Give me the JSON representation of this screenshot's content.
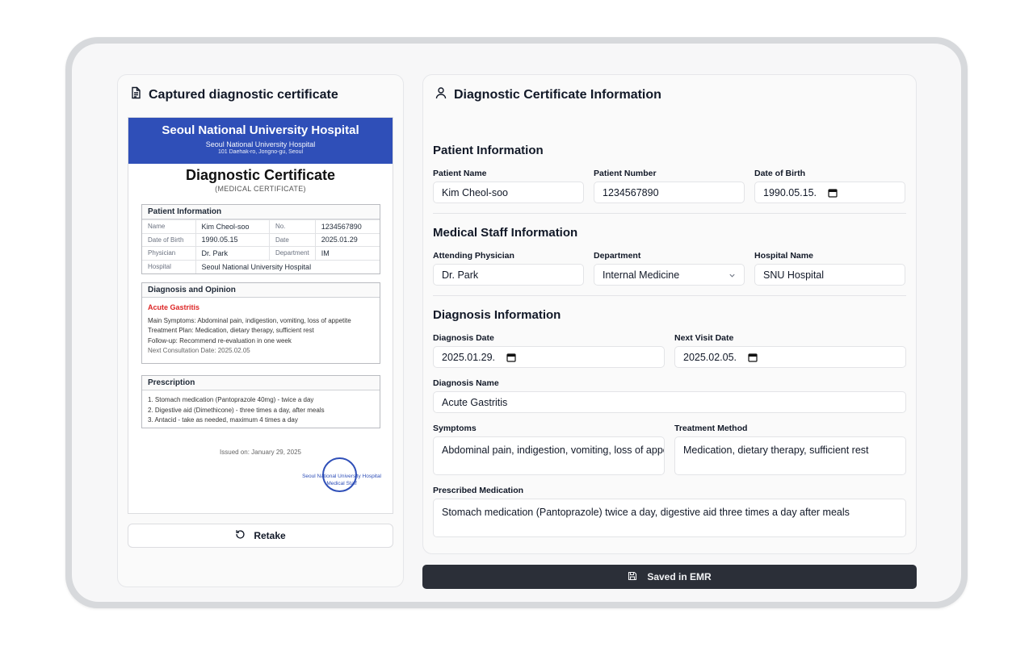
{
  "left": {
    "title": "Captured diagnostic certificate",
    "retake_label": "Retake"
  },
  "cert": {
    "hospital_name": "Seoul National University Hospital",
    "hospital_sub": "Seoul National University Hospital",
    "address": "101 Daehak-ro, Jongno-gu, Seoul",
    "title": "Diagnostic Certificate",
    "subtitle": "(MEDICAL CERTIFICATE)",
    "patient_info": {
      "heading": "Patient Information",
      "name_label": "Name",
      "name": "Kim Cheol-soo",
      "no_label": "No.",
      "no": "1234567890",
      "dob_label": "Date of Birth",
      "dob": "1990.05.15",
      "date_label": "Date",
      "date": "2025.01.29",
      "physician_label": "Physician",
      "physician": "Dr. Park",
      "department_label": "Department",
      "department": "IM",
      "hospital_label": "Hospital",
      "hospital": "Seoul National University Hospital"
    },
    "diagnosis": {
      "heading": "Diagnosis and Opinion",
      "name": "Acute Gastritis",
      "symptoms": "Main Symptoms: Abdominal pain, indigestion, vomiting, loss of appetite",
      "treatment": "Treatment Plan: Medication, dietary therapy, sufficient rest",
      "followup": "Follow-up: Recommend re-evaluation in one week",
      "next": "Next Consultation Date: 2025.02.05"
    },
    "prescription": {
      "heading": "Prescription",
      "items": [
        "1. Stomach medication (Pantoprazole 40mg) - twice a day",
        "2. Digestive aid (Dimethicone) - three times a day, after meals",
        "3. Antacid - take as needed, maximum 4 times a day"
      ]
    },
    "issued": "Issued on: January 29, 2025",
    "stamp_line1": "Seoul National University Hospital",
    "stamp_line2": "Medical Staff"
  },
  "right": {
    "title": "Diagnostic Certificate Information",
    "patient_section": "Patient Information",
    "patient_name_label": "Patient Name",
    "patient_name": "Kim Cheol-soo",
    "patient_number_label": "Patient Number",
    "patient_number": "1234567890",
    "dob_label": "Date of Birth",
    "dob": "1990.05.15.",
    "staff_section": "Medical Staff Information",
    "physician_label": "Attending Physician",
    "physician": "Dr. Park",
    "department_label": "Department",
    "department": "Internal Medicine",
    "hospital_label": "Hospital Name",
    "hospital": "SNU Hospital",
    "diagnosis_section": "Diagnosis Information",
    "diag_date_label": "Diagnosis Date",
    "diag_date": "2025.01.29.",
    "next_visit_label": "Next Visit Date",
    "next_visit": "2025.02.05.",
    "diag_name_label": "Diagnosis Name",
    "diag_name": "Acute Gastritis",
    "symptoms_label": "Symptoms",
    "symptoms": "Abdominal pain, indigestion, vomiting, loss of appet",
    "treatment_label": "Treatment Method",
    "treatment": "Medication, dietary therapy, sufficient rest",
    "medication_label": "Prescribed Medication",
    "medication": "Stomach medication (Pantoprazole) twice a day, digestive aid three times a day after meals"
  },
  "save_label": "Saved in EMR"
}
